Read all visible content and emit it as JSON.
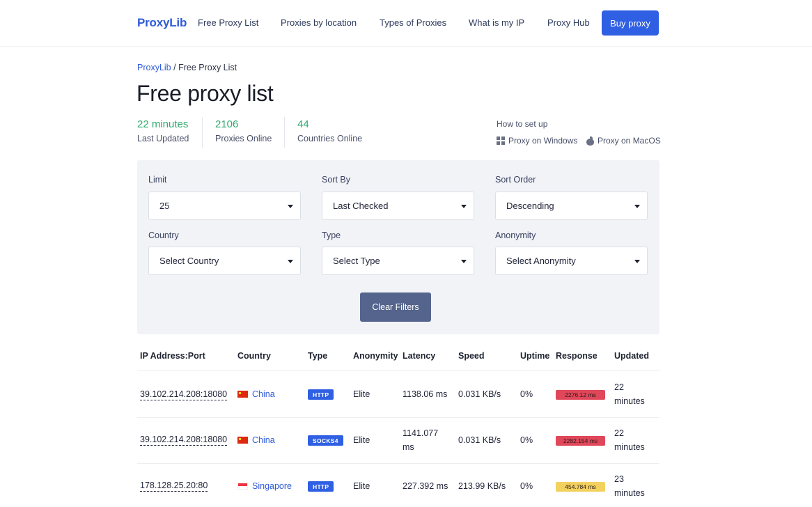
{
  "header": {
    "logo": "ProxyLib",
    "nav": [
      "Free Proxy List",
      "Proxies by location",
      "Types of Proxies",
      "What is my IP",
      "Proxy Hub"
    ],
    "buy_label": "Buy proxy"
  },
  "breadcrumb": {
    "home": "ProxyLib",
    "separator": " / ",
    "current": "Free Proxy List"
  },
  "title": "Free proxy list",
  "stats": [
    {
      "value": "22 minutes",
      "label": "Last Updated"
    },
    {
      "value": "2106",
      "label": "Proxies Online"
    },
    {
      "value": "44",
      "label": "Countries Online"
    }
  ],
  "howto": {
    "label": "How to set up",
    "windows": "Proxy on Windows",
    "macos": "Proxy on MacOS"
  },
  "filters": {
    "limit": {
      "label": "Limit",
      "value": "25"
    },
    "sort_by": {
      "label": "Sort By",
      "value": "Last Checked"
    },
    "sort_order": {
      "label": "Sort Order",
      "value": "Descending"
    },
    "country": {
      "label": "Country",
      "value": "Select Country"
    },
    "type": {
      "label": "Type",
      "value": "Select Type"
    },
    "anonymity": {
      "label": "Anonymity",
      "value": "Select Anonymity"
    },
    "clear_label": "Clear Filters"
  },
  "table": {
    "headers": [
      "IP Address:Port",
      "Country",
      "Type",
      "Anonymity",
      "Latency",
      "Speed",
      "Uptime",
      "Response",
      "Updated"
    ],
    "rows": [
      {
        "ip": "39.102.214.208:18080",
        "country": "China",
        "type": "HTTP",
        "anonymity": "Elite",
        "latency": "1138.06 ms",
        "speed": "0.031 KB/s",
        "uptime": "0%",
        "response": "2276.12 ms",
        "updated_1": "22",
        "updated_2": "minutes"
      },
      {
        "ip": "39.102.214.208:18080",
        "country": "China",
        "type": "SOCKS4",
        "anonymity": "Elite",
        "latency_1": "1141.077",
        "latency_2": "ms",
        "speed": "0.031 KB/s",
        "uptime": "0%",
        "response": "2282.154 ms",
        "updated_1": "22",
        "updated_2": "minutes"
      },
      {
        "ip": "178.128.25.20:80",
        "country": "Singapore",
        "type": "HTTP",
        "anonymity": "Elite",
        "latency": "227.392 ms",
        "speed": "213.99 KB/s",
        "uptime": "0%",
        "response": "454.784 ms",
        "updated_1": "23",
        "updated_2": "minutes"
      }
    ]
  },
  "colors": {
    "accent": "#2f5fe3",
    "stat_green": "#2faa6e",
    "response_red": "#e0475a",
    "response_yellow": "#f3d15e"
  }
}
